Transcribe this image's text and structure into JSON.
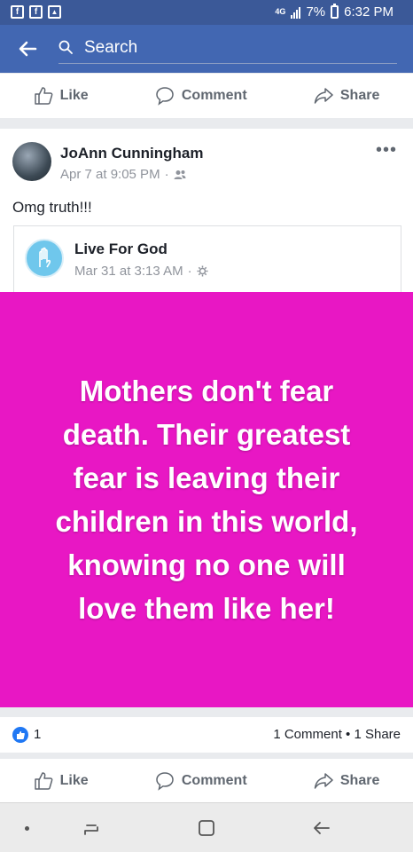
{
  "status_bar": {
    "network": "4G",
    "battery": "7%",
    "time": "6:32 PM",
    "left_icons": [
      "facebook-icon",
      "facebook-icon",
      "gallery-icon"
    ]
  },
  "header": {
    "search_placeholder": "Search"
  },
  "top_actions": {
    "like": "Like",
    "comment": "Comment",
    "share": "Share"
  },
  "post": {
    "author": "JoAnn Cunningham",
    "date": "Apr 7 at 9:05 PM",
    "audience_icon": "friends-icon",
    "text": "Omg truth!!!",
    "shared": {
      "author": "Live For God",
      "date": "Mar 31 at 3:13 AM",
      "audience_icon": "public-gear-icon",
      "image_text": "Mothers don't fear death. Their greatest fear is leaving their children in this world, knowing no one will love them like her!",
      "image_bg": "#e817c4"
    },
    "reactions": {
      "like_count": "1",
      "summary": "1 Comment • 1 Share"
    }
  },
  "bottom_actions": {
    "like": "Like",
    "comment": "Comment",
    "share": "Share"
  },
  "colors": {
    "brand": "#3b5998",
    "header": "#4267b2",
    "like_blue": "#2078f4"
  }
}
